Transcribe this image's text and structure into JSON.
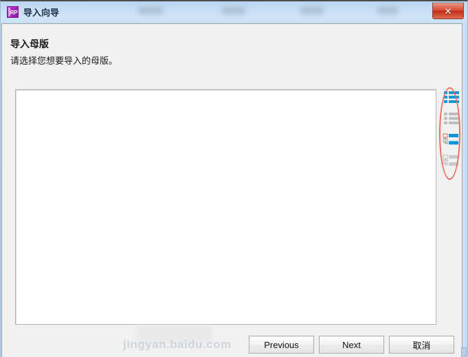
{
  "window": {
    "title": "导入向导",
    "app_icon_label": "RP",
    "close_label": "✕"
  },
  "header": {
    "title": "导入母版",
    "subtitle": "请选择您想要导入的母版。"
  },
  "list_panel": {
    "content": "",
    "placeholder": ""
  },
  "view_toolbar": {
    "items": [
      {
        "name": "list-view-active-icon",
        "label": "列表视图",
        "state": "active",
        "color": "#0896d8"
      },
      {
        "name": "list-view-icon",
        "label": "列表视图（灰）",
        "state": "inactive",
        "color": "#b6b6b6"
      },
      {
        "name": "tree-view-active-icon",
        "label": "树形视图",
        "state": "active",
        "color": "#0896d8"
      },
      {
        "name": "tree-view-icon",
        "label": "树形视图（灰）",
        "state": "inactive",
        "color": "#b6b6b6"
      }
    ]
  },
  "annotation": {
    "shape": "ellipse",
    "color": "#f06a63",
    "target": "view-toolbar"
  },
  "footer": {
    "previous_label": "Previous",
    "next_label": "Next",
    "cancel_label": "取消"
  },
  "watermark": {
    "text": "jingyan.baidu.com"
  },
  "colors": {
    "titlebar_blue": "#c6def5",
    "client_gray": "#f1f1f1",
    "panel_white": "#ffffff",
    "accent_blue": "#0896d8",
    "annotation_red": "#f06a63",
    "close_red": "#c22d18",
    "app_icon_purple": "#a623bb"
  }
}
